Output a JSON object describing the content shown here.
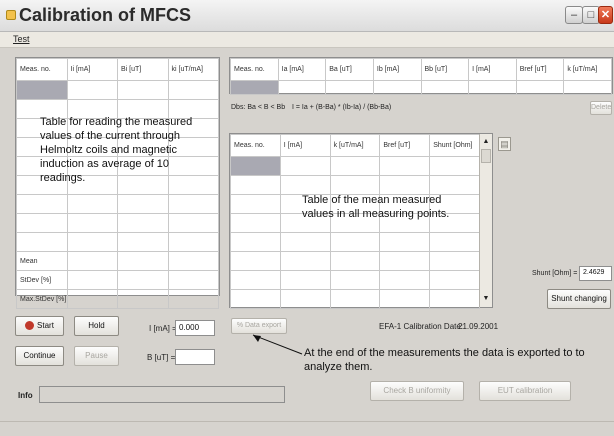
{
  "window": {
    "title": "Calibration of MFCS"
  },
  "menu": {
    "test": "Test"
  },
  "left_table": {
    "headers": [
      "Meas. no.",
      "Ii [mA]",
      "Bi [uT]",
      "ki [uT/mA]"
    ],
    "stats": [
      "Mean",
      "StDev [%]",
      "Max.StDev [%]"
    ]
  },
  "top_right_table": {
    "headers": [
      "Meas. no.",
      "Ia [mA]",
      "Ba [uT]",
      "Ib [mA]",
      "Bb [uT]",
      "I [mA]",
      "Bref [uT]",
      "k [uT/mA]"
    ]
  },
  "formula": {
    "condition": "Dbs: Ba < B < Bb",
    "equation": "I = Ia + (B-Ba) * (Ib-Ia) / (Bb-Ba)",
    "delete_label": "Delete"
  },
  "mid_table": {
    "headers": [
      "Meas. no.",
      "I [mA]",
      "k [uT/mA]",
      "Bref [uT]",
      "Shunt [Ohm]"
    ]
  },
  "annotations": {
    "left": "Table for reading the measured values of the current through Helmoltz coils and magnetic induction as average of 10 readings.",
    "mid": "Table of the mean measured values in all measuring points.",
    "bottom": "At the end of the measurements the data is exported to to analyze them."
  },
  "shunt": {
    "label": "Shunt [Ohm] =",
    "value": "2.4629",
    "button": "Shunt changing"
  },
  "controls": {
    "start": "Start",
    "hold": "Hold",
    "continue": "Continue",
    "pause": "Pause",
    "i_label": "I [mA] =",
    "i_value": "0.000",
    "b_label": "B [uT] =",
    "b_value": "",
    "data_export": "Data export",
    "calibration_date_label": "EFA-1 Calibration Date:",
    "calibration_date": "21.09.2001",
    "check_uniformity": "Check B uniformity",
    "eut_calibration": "EUT calibration",
    "info_label": "Info",
    "info_value": ""
  },
  "colors": {
    "background": "#d6d3ce",
    "selected_cell": "#a9a9b2",
    "start_icon": "#c0392b"
  },
  "icons": {
    "scroll_up": "triangle-up",
    "scroll_down": "triangle-down",
    "stop": "stop-sign",
    "clipboard": "clipboard"
  }
}
